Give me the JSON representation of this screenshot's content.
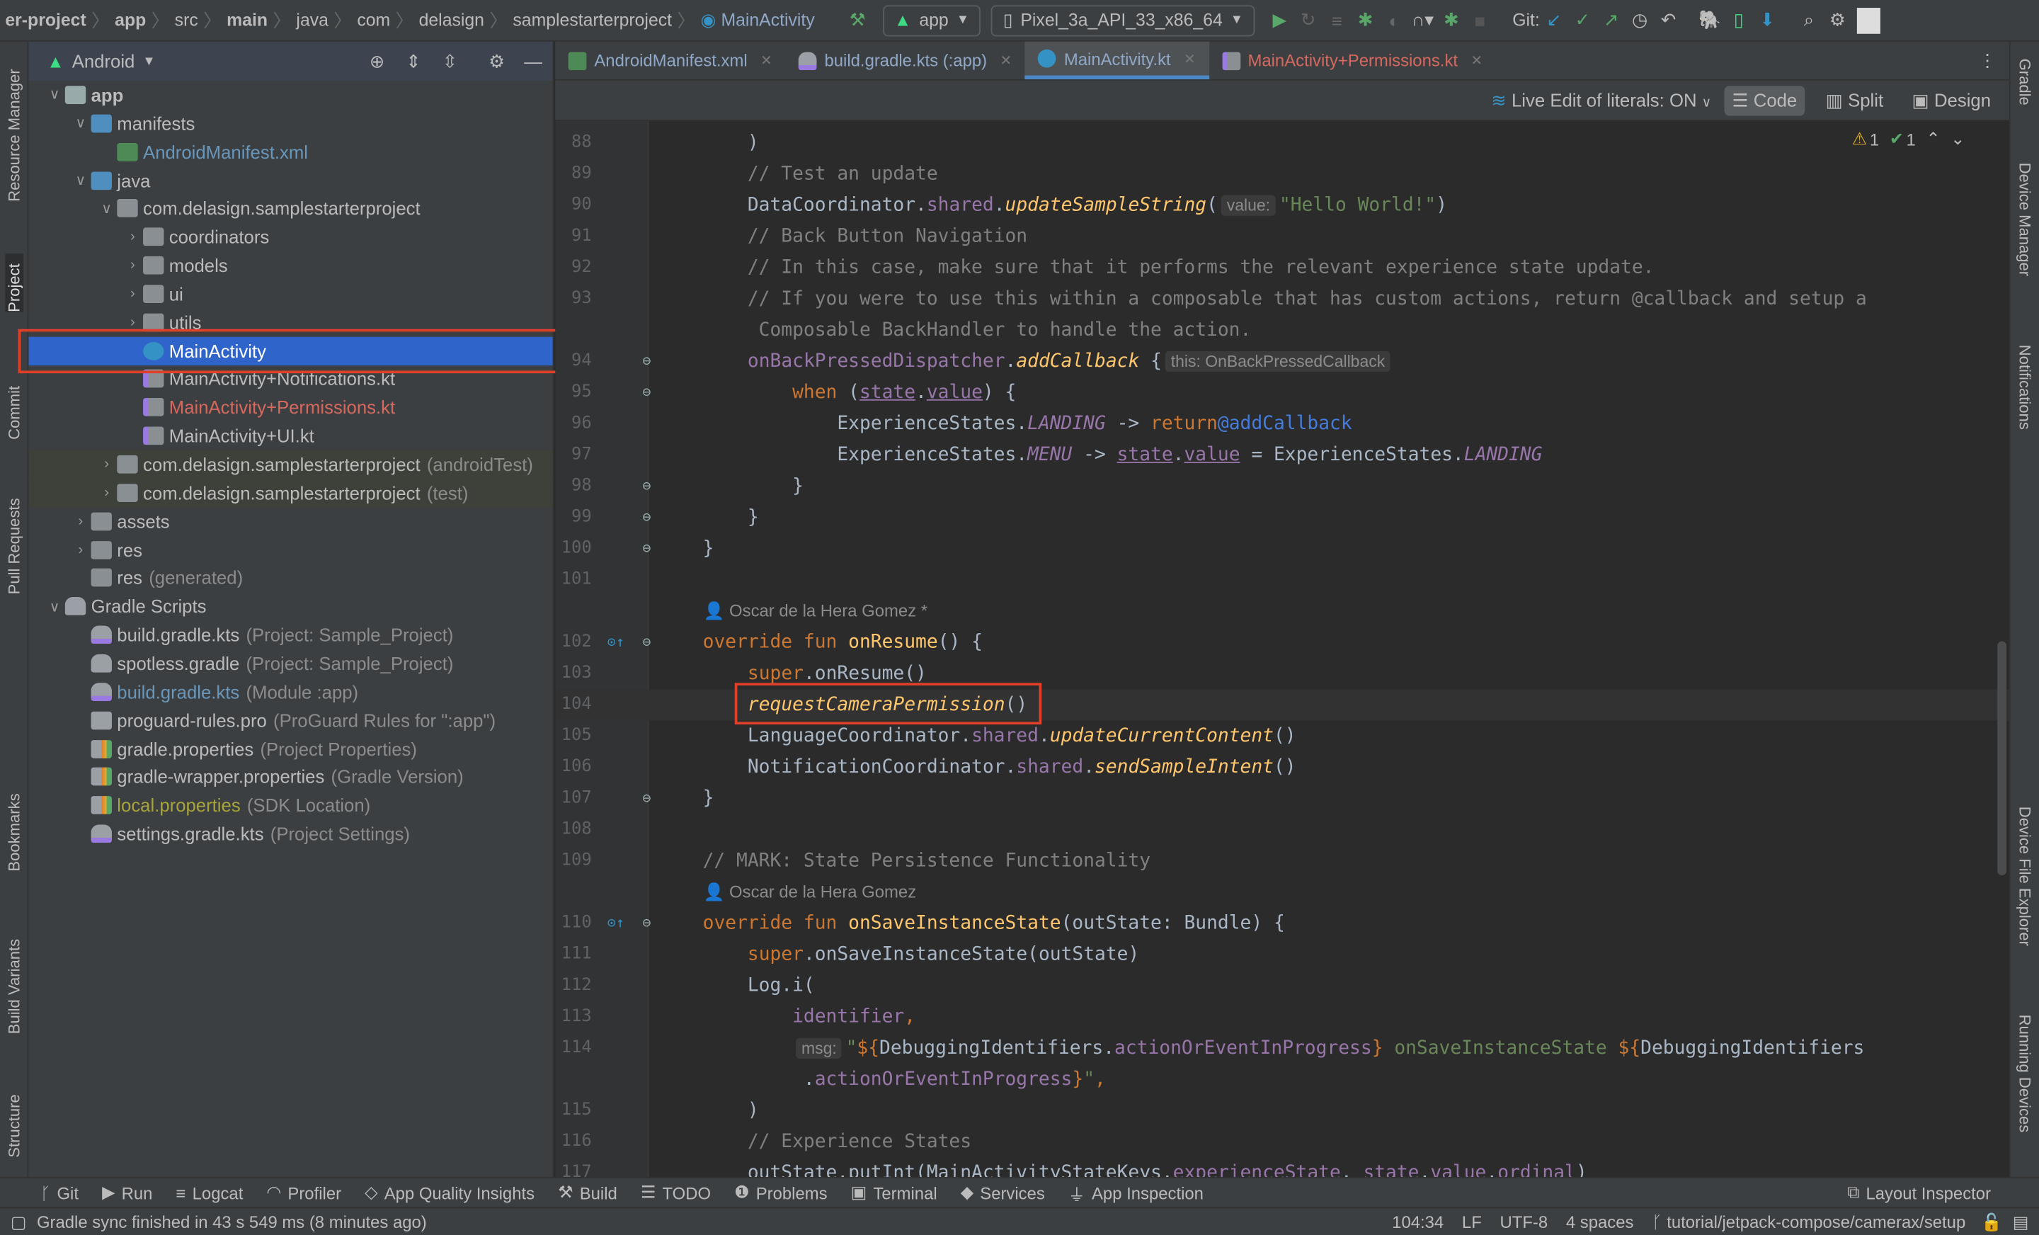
{
  "colors": {
    "accent": "#2f65ca",
    "highlight_box": "#e0402a",
    "modified_file": "#6897bb",
    "error_file": "#d6695e",
    "ignored_file": "#a8a43c"
  },
  "breadcrumbs": [
    "er-project",
    "app",
    "src",
    "main",
    "java",
    "com",
    "delasign",
    "samplestarterproject",
    "MainActivity"
  ],
  "toolbar": {
    "run_config": "app",
    "device": "Pixel_3a_API_33_x86_64",
    "git_label": "Git:",
    "icons": [
      "hammer-icon",
      "run-icon",
      "apply-changes-icon",
      "debug-icon",
      "profile-icon",
      "stop-icon",
      "git-update-icon",
      "git-commit-icon",
      "git-push-icon",
      "history-icon",
      "rollback-icon",
      "gradle-sync-icon",
      "device-manager-icon",
      "sdk-manager-icon",
      "search-icon",
      "settings-icon",
      "avatar"
    ]
  },
  "left_strip": [
    "Resource Manager",
    "Project",
    "Commit",
    "Pull Requests",
    "Bookmarks",
    "Build Variants",
    "Structure"
  ],
  "right_strip": [
    "Gradle",
    "Device Manager",
    "Notifications",
    "Device File Explorer",
    "Running Devices"
  ],
  "project": {
    "view": "Android",
    "tree": [
      {
        "label": "app",
        "depth": 0,
        "arrow": "down",
        "icon": "module",
        "bold": true
      },
      {
        "label": "manifests",
        "depth": 1,
        "arrow": "down",
        "icon": "folder-blue"
      },
      {
        "label": "AndroidManifest.xml",
        "depth": 2,
        "icon": "manifest",
        "color": "#6897bb"
      },
      {
        "label": "java",
        "depth": 1,
        "arrow": "down",
        "icon": "folder-blue"
      },
      {
        "label": "com.delasign.samplestarterproject",
        "depth": 2,
        "arrow": "down",
        "icon": "package"
      },
      {
        "label": "coordinators",
        "depth": 3,
        "arrow": "right",
        "icon": "package"
      },
      {
        "label": "models",
        "depth": 3,
        "arrow": "right",
        "icon": "package"
      },
      {
        "label": "ui",
        "depth": 3,
        "arrow": "right",
        "icon": "package"
      },
      {
        "label": "utils",
        "depth": 3,
        "arrow": "right",
        "icon": "package"
      },
      {
        "label": "MainActivity",
        "depth": 3,
        "icon": "kotlin-class",
        "selected": true
      },
      {
        "label": "MainActivity+Notifications.kt",
        "depth": 3,
        "icon": "kotlin-file"
      },
      {
        "label": "MainActivity+Permissions.kt",
        "depth": 3,
        "icon": "kotlin-file",
        "color": "#d6695e"
      },
      {
        "label": "MainActivity+UI.kt",
        "depth": 3,
        "icon": "kotlin-file"
      },
      {
        "label": "com.delasign.samplestarterproject",
        "secondary": "(androidTest)",
        "depth": 2,
        "arrow": "right",
        "icon": "package",
        "test": true
      },
      {
        "label": "com.delasign.samplestarterproject",
        "secondary": "(test)",
        "depth": 2,
        "arrow": "right",
        "icon": "package",
        "test": true
      },
      {
        "label": "assets",
        "depth": 1,
        "arrow": "right",
        "icon": "folder"
      },
      {
        "label": "res",
        "depth": 1,
        "arrow": "right",
        "icon": "folder-res"
      },
      {
        "label": "res",
        "secondary": "(generated)",
        "depth": 1,
        "icon": "folder-res"
      },
      {
        "label": "Gradle Scripts",
        "depth": 0,
        "arrow": "down",
        "icon": "gradle"
      },
      {
        "label": "build.gradle.kts",
        "secondary": "(Project: Sample_Project)",
        "depth": 1,
        "icon": "gradle-kts"
      },
      {
        "label": "spotless.gradle",
        "secondary": "(Project: Sample_Project)",
        "depth": 1,
        "icon": "gradle"
      },
      {
        "label": "build.gradle.kts",
        "secondary": "(Module :app)",
        "depth": 1,
        "icon": "gradle-kts",
        "color": "#6897bb"
      },
      {
        "label": "proguard-rules.pro",
        "secondary": "(ProGuard Rules for \":app\")",
        "depth": 1,
        "icon": "text-file"
      },
      {
        "label": "gradle.properties",
        "secondary": "(Project Properties)",
        "depth": 1,
        "icon": "properties"
      },
      {
        "label": "gradle-wrapper.properties",
        "secondary": "(Gradle Version)",
        "depth": 1,
        "icon": "properties"
      },
      {
        "label": "local.properties",
        "secondary": "(SDK Location)",
        "depth": 1,
        "icon": "properties",
        "color": "#a8a43c"
      },
      {
        "label": "settings.gradle.kts",
        "secondary": "(Project Settings)",
        "depth": 1,
        "icon": "gradle-kts"
      }
    ]
  },
  "tabs": [
    {
      "label": "AndroidManifest.xml",
      "icon": "manifest",
      "color": "#8fa8c8"
    },
    {
      "label": "build.gradle.kts (:app)",
      "icon": "gradle-kts",
      "color": "#8fa8c8"
    },
    {
      "label": "MainActivity.kt",
      "icon": "kotlin-class",
      "color": "#8fa8c8",
      "active": true
    },
    {
      "label": "MainActivity+Permissions.kt",
      "icon": "kotlin-file",
      "color": "#d6695e"
    }
  ],
  "editor_toolbar": {
    "live_edit": "Live Edit of literals: ON",
    "modes": [
      "Code",
      "Split",
      "Design"
    ],
    "active_mode": "Code",
    "warnings": "1",
    "weak_warnings": "1"
  },
  "editor": {
    "current_line": "104",
    "lines": [
      {
        "n": "88",
        "tokens": [
          [
            "        )",
            ""
          ]
        ]
      },
      {
        "n": "89",
        "tokens": [
          [
            "        // Test an update",
            "cm"
          ]
        ]
      },
      {
        "n": "90",
        "tokens": [
          [
            "        DataCoordinator.",
            ""
          ],
          [
            "shared",
            "prop"
          ],
          [
            ".",
            ""
          ],
          [
            "updateSampleString",
            "fn"
          ],
          [
            "(",
            ""
          ],
          [
            "value:",
            "hint"
          ],
          [
            "\"Hello World!\"",
            "str"
          ],
          [
            ")",
            ""
          ]
        ]
      },
      {
        "n": "91",
        "tokens": [
          [
            "        // Back Button Navigation",
            "cm"
          ]
        ]
      },
      {
        "n": "92",
        "tokens": [
          [
            "        // In this case, make sure that it performs the relevant experience state update.",
            "cm"
          ]
        ]
      },
      {
        "n": "93",
        "tokens": [
          [
            "        // If you were to use this within a composable that has custom actions, return @callback and setup a",
            "cm"
          ]
        ]
      },
      {
        "n": "",
        "tokens": [
          [
            "         Composable BackHandler to handle the action.",
            "cm"
          ]
        ]
      },
      {
        "n": "94",
        "fold": true,
        "tokens": [
          [
            "        ",
            ""
          ],
          [
            "onBackPressedDispatcher",
            "prop"
          ],
          [
            ".",
            ""
          ],
          [
            "addCallback",
            "fn"
          ],
          [
            " {",
            ""
          ],
          [
            "this: OnBackPressedCallback",
            "hint"
          ]
        ]
      },
      {
        "n": "95",
        "fold": true,
        "tokens": [
          [
            "            ",
            ""
          ],
          [
            "when",
            "kw"
          ],
          [
            " (",
            ""
          ],
          [
            "state",
            "prop ul"
          ],
          [
            ".",
            ""
          ],
          [
            "value",
            "prop ul"
          ],
          [
            ") {",
            ""
          ]
        ]
      },
      {
        "n": "96",
        "tokens": [
          [
            "                ExperienceStates.",
            ""
          ],
          [
            "LANDING",
            "en"
          ],
          [
            " -> ",
            ""
          ],
          [
            "return",
            "kw"
          ],
          [
            "@addCallback",
            "lbl"
          ]
        ]
      },
      {
        "n": "97",
        "tokens": [
          [
            "                ExperienceStates.",
            ""
          ],
          [
            "MENU",
            "en"
          ],
          [
            " -> ",
            ""
          ],
          [
            "state",
            "prop ul"
          ],
          [
            ".",
            ""
          ],
          [
            "value",
            "prop ul"
          ],
          [
            " = ExperienceStates.",
            ""
          ],
          [
            "LANDING",
            "en"
          ]
        ]
      },
      {
        "n": "98",
        "fold": true,
        "tokens": [
          [
            "            }",
            ""
          ]
        ]
      },
      {
        "n": "99",
        "fold": true,
        "tokens": [
          [
            "        }",
            ""
          ]
        ]
      },
      {
        "n": "100",
        "fold": true,
        "tokens": [
          [
            "    }",
            ""
          ]
        ]
      },
      {
        "n": "101",
        "tokens": []
      },
      {
        "n": "",
        "author": "Oscar de la Hera Gomez *"
      },
      {
        "n": "102",
        "override": true,
        "fold": true,
        "tokens": [
          [
            "    ",
            ""
          ],
          [
            "override fun ",
            "kw"
          ],
          [
            "onResume",
            "fnd"
          ],
          [
            "() {",
            ""
          ]
        ]
      },
      {
        "n": "103",
        "tokens": [
          [
            "        ",
            ""
          ],
          [
            "super",
            "kw"
          ],
          [
            ".onResume()",
            ""
          ]
        ]
      },
      {
        "n": "104",
        "tokens": [
          [
            "        ",
            ""
          ],
          [
            "requestCameraPermission",
            "fn"
          ],
          [
            "()",
            ""
          ]
        ]
      },
      {
        "n": "105",
        "tokens": [
          [
            "        LanguageCoordinator.",
            ""
          ],
          [
            "shared",
            "prop"
          ],
          [
            ".",
            ""
          ],
          [
            "updateCurrentContent",
            "fn"
          ],
          [
            "()",
            ""
          ]
        ]
      },
      {
        "n": "106",
        "tokens": [
          [
            "        NotificationCoordinator.",
            ""
          ],
          [
            "shared",
            "prop"
          ],
          [
            ".",
            ""
          ],
          [
            "sendSampleIntent",
            "fn"
          ],
          [
            "()",
            ""
          ]
        ]
      },
      {
        "n": "107",
        "fold": true,
        "tokens": [
          [
            "    }",
            ""
          ]
        ]
      },
      {
        "n": "108",
        "tokens": []
      },
      {
        "n": "109",
        "tokens": [
          [
            "    // MARK: State Persistence Functionality",
            "cm"
          ]
        ]
      },
      {
        "n": "",
        "author": "Oscar de la Hera Gomez"
      },
      {
        "n": "110",
        "override": true,
        "fold": true,
        "tokens": [
          [
            "    ",
            ""
          ],
          [
            "override fun ",
            "kw"
          ],
          [
            "onSaveInstanceState",
            "fnd"
          ],
          [
            "(outState: Bundle) {",
            ""
          ]
        ]
      },
      {
        "n": "111",
        "tokens": [
          [
            "        ",
            ""
          ],
          [
            "super",
            "kw"
          ],
          [
            ".onSaveInstanceState(outState)",
            ""
          ]
        ]
      },
      {
        "n": "112",
        "tokens": [
          [
            "        Log.i(",
            ""
          ]
        ]
      },
      {
        "n": "113",
        "tokens": [
          [
            "            ",
            ""
          ],
          [
            "identifier",
            "prop"
          ],
          [
            ",",
            "kw"
          ]
        ]
      },
      {
        "n": "114",
        "tokens": [
          [
            "            ",
            ""
          ],
          [
            "msg:",
            "hint"
          ],
          [
            "\"",
            "str"
          ],
          [
            "${",
            "kw"
          ],
          [
            "DebuggingIdentifiers.",
            ""
          ],
          [
            "actionOrEventInProgress",
            "prop"
          ],
          [
            "}",
            "kw"
          ],
          [
            " onSaveInstanceState ",
            "str"
          ],
          [
            "${",
            "kw"
          ],
          [
            "DebuggingIdentifiers",
            ""
          ]
        ]
      },
      {
        "n": "",
        "tokens": [
          [
            "             .",
            ""
          ],
          [
            "actionOrEventInProgress",
            "prop"
          ],
          [
            "}",
            "kw"
          ],
          [
            "\"",
            "str"
          ],
          [
            ",",
            "kw"
          ]
        ]
      },
      {
        "n": "115",
        "tokens": [
          [
            "        )",
            ""
          ]
        ]
      },
      {
        "n": "116",
        "tokens": [
          [
            "        // Experience States",
            "cm"
          ]
        ]
      },
      {
        "n": "117",
        "tokens": [
          [
            "        outState.putInt(MainActivityStateKeys.",
            ""
          ],
          [
            "experienceState",
            "prop"
          ],
          [
            ", ",
            ""
          ],
          [
            "state",
            "prop"
          ],
          [
            ".",
            ""
          ],
          [
            "value",
            "prop"
          ],
          [
            ".",
            ""
          ],
          [
            "ordinal",
            "prop"
          ],
          [
            ")",
            ""
          ]
        ]
      }
    ]
  },
  "bottom_tools": [
    "Git",
    "Run",
    "Logcat",
    "Profiler",
    "App Quality Insights",
    "Build",
    "TODO",
    "Problems",
    "Terminal",
    "Services",
    "App Inspection"
  ],
  "bottom_right": "Layout Inspector",
  "status": {
    "message": "Gradle sync finished in 43 s 549 ms (8 minutes ago)",
    "position": "104:34",
    "line_sep": "LF",
    "encoding": "UTF-8",
    "indent": "4 spaces",
    "branch": "tutorial/jetpack-compose/camerax/setup"
  }
}
